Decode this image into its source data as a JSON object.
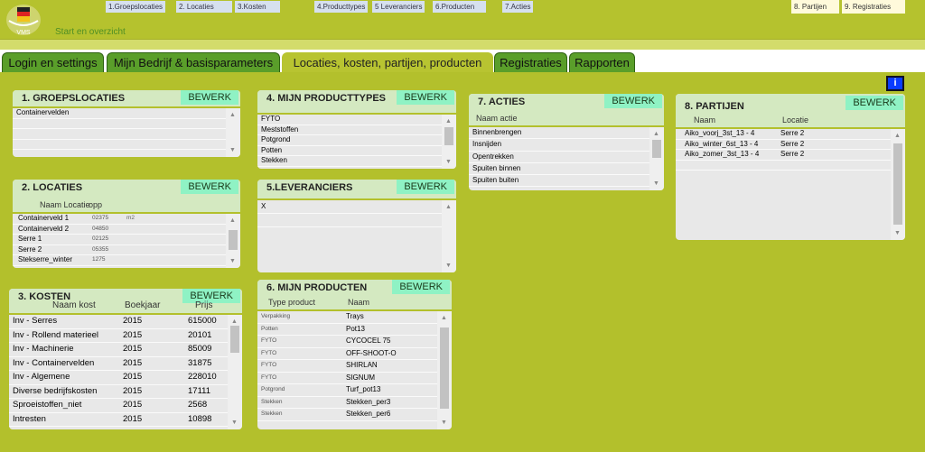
{
  "header": {
    "logo_text": "VMS",
    "start_link": "Start en overzicht",
    "nav": [
      "1.Groepslocaties",
      "2. Locaties",
      "3.Kosten",
      "4.Producttypes",
      "5 Leveranciers",
      "6.Producten",
      "7.Acties",
      "8. Partijen",
      "9. Registraties"
    ]
  },
  "tabs": [
    {
      "label": "Login en settings"
    },
    {
      "label": "Mijn Bedrijf & basisparameters"
    },
    {
      "label": "Locaties, kosten, partijen, producten",
      "active": true
    },
    {
      "label": "Registraties"
    },
    {
      "label": "Rapporten"
    }
  ],
  "info_label": "i",
  "edit_label": "BEWERK",
  "panels": {
    "groepslocaties": {
      "title": "1. GROEPSLOCATIES",
      "rows": [
        [
          "Containervelden"
        ],
        [
          ""
        ],
        [
          ""
        ],
        [
          ""
        ]
      ]
    },
    "locaties": {
      "title": "2. LOCATIES",
      "columns": [
        "Naam Locatie",
        "opp"
      ],
      "unit": "m2",
      "rows": [
        [
          "Containerveld 1",
          "02375"
        ],
        [
          "Containerveld 2",
          "04850"
        ],
        [
          "Serre 1",
          "02125"
        ],
        [
          "Serre 2",
          "05355"
        ],
        [
          "Stekserre_winter",
          "1275"
        ]
      ]
    },
    "kosten": {
      "title": "3. KOSTEN",
      "columns": [
        "Naam kost",
        "Boekjaar",
        "Prijs"
      ],
      "rows": [
        [
          "Inv - Serres",
          "2015",
          "615000"
        ],
        [
          "Inv - Rollend materieel",
          "2015",
          "20101"
        ],
        [
          "Inv - Machinerie",
          "2015",
          "85009"
        ],
        [
          "Inv - Containervelden",
          "2015",
          "31875"
        ],
        [
          "Inv - Algemene",
          "2015",
          "228010"
        ],
        [
          "Diverse bedrijfskosten",
          "2015",
          "17111"
        ],
        [
          "Sproeistoffen_niet",
          "2015",
          "2568"
        ],
        [
          "Intresten",
          "2015",
          "10898"
        ]
      ]
    },
    "producttypes": {
      "title": "4. MIJN PRODUCTTYPES",
      "rows": [
        [
          "FYTO"
        ],
        [
          "Meststoffen"
        ],
        [
          "Potgrond"
        ],
        [
          "Potten"
        ],
        [
          "Stekken"
        ]
      ]
    },
    "leveranciers": {
      "title": "5.LEVERANCIERS",
      "rows": [
        [
          "X"
        ],
        [
          ""
        ]
      ]
    },
    "producten": {
      "title": "6. MIJN PRODUCTEN",
      "columns": [
        "Type product",
        "Naam"
      ],
      "rows": [
        [
          "Verpakking",
          "Trays"
        ],
        [
          "Potten",
          "Pot13"
        ],
        [
          "FYTO",
          "CYCOCEL 75"
        ],
        [
          "FYTO",
          "OFF-SHOOT-O"
        ],
        [
          "FYTO",
          "SHIRLAN"
        ],
        [
          "FYTO",
          "SIGNUM"
        ],
        [
          "Potgrond",
          "Turf_pot13"
        ],
        [
          "Stekken",
          "Stekken_per3"
        ],
        [
          "Stekken",
          "Stekken_per6"
        ],
        [
          "",
          ""
        ]
      ]
    },
    "acties": {
      "title": "7. ACTIES",
      "columns": [
        "Naam actie"
      ],
      "rows": [
        [
          "Binnenbrengen"
        ],
        [
          "Insnijden"
        ],
        [
          "Opentrekken"
        ],
        [
          "Spuiten binnen"
        ],
        [
          "Spuiten buiten"
        ]
      ]
    },
    "partijen": {
      "title": "8. PARTIJEN",
      "columns": [
        "Naam",
        "Locatie"
      ],
      "rows": [
        [
          "Aiko_voorj_3st_13 - 4",
          "Serre 2"
        ],
        [
          "Aiko_winter_6st_13 - 4",
          "Serre 2"
        ],
        [
          "Aiko_zomer_3st_13 - 4",
          "Serre 2"
        ],
        [
          "",
          ""
        ]
      ]
    }
  }
}
